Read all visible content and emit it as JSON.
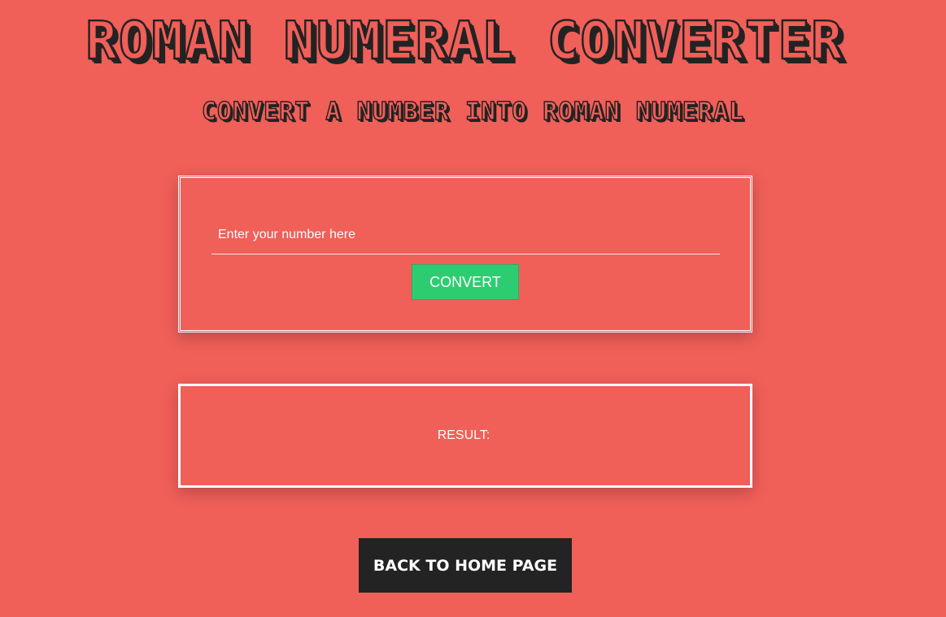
{
  "header": {
    "title": "ROMAN NUMERAL CONVERTER",
    "subtitle": "CONVERT A NUMBER INTO ROMAN NUMERAL"
  },
  "converter": {
    "input_value": "",
    "input_placeholder": "Enter your number here",
    "convert_label": "CONVERT"
  },
  "result": {
    "label": "RESULT:",
    "value": ""
  },
  "footer": {
    "back_label": "BACK TO HOME PAGE"
  },
  "colors": {
    "background": "#f05f58",
    "text_dark": "#232323",
    "convert_button": "#2ecc71",
    "border": "#ffffff"
  }
}
